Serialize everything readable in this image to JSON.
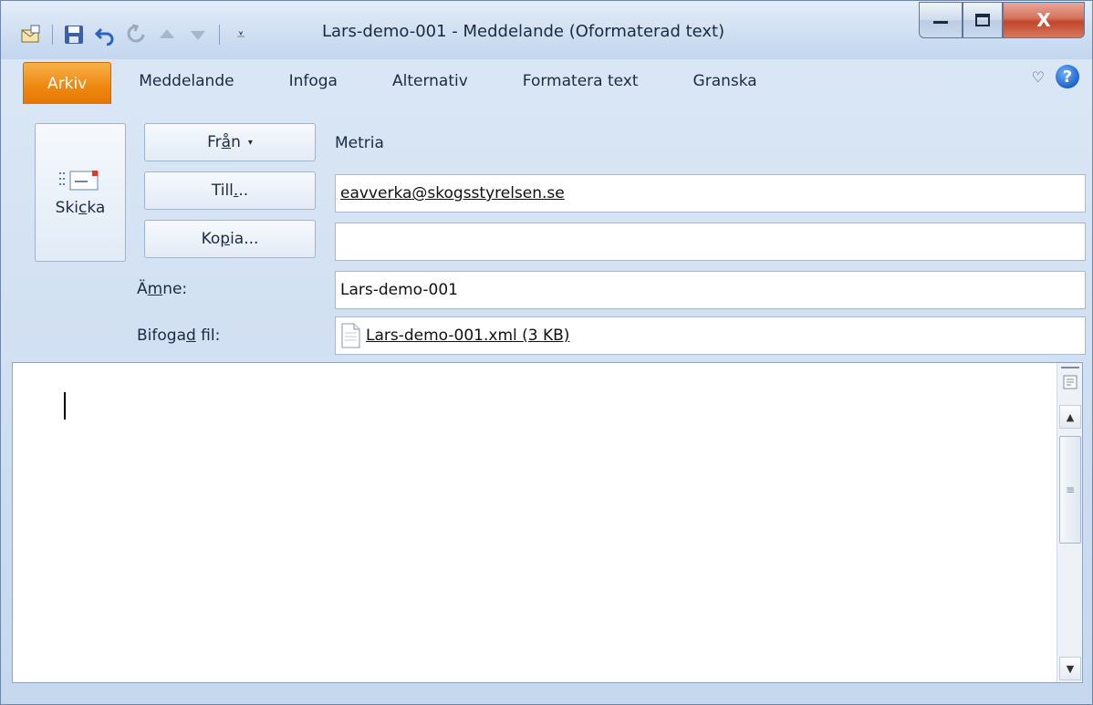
{
  "window": {
    "title": "Lars-demo-001  -  Meddelande (Oformaterad text)",
    "controls": {
      "minimize": "—",
      "maximize": "▢",
      "close": "X"
    }
  },
  "quick_access": {
    "icons": [
      "mail-icon",
      "save-icon",
      "undo-icon",
      "redo-icon",
      "up-arrow-icon",
      "down-arrow-icon",
      "customize-icon"
    ],
    "customize_glyph": "⩡"
  },
  "ribbon": {
    "tabs": [
      {
        "label": "Arkiv"
      },
      {
        "label": "Meddelande"
      },
      {
        "label": "Infoga"
      },
      {
        "label": "Alternativ"
      },
      {
        "label": "Formatera text"
      },
      {
        "label": "Granska"
      }
    ],
    "collapse_glyph": "♡",
    "help_glyph": "?"
  },
  "compose": {
    "send": {
      "pre": "Ski",
      "acc": "c",
      "post": "ka"
    },
    "from_button": {
      "pre": "Fr",
      "acc": "å",
      "post": "n",
      "caret": "▾"
    },
    "from_value": "Metria",
    "to_button": {
      "pre": "Till",
      "acc": ".",
      "post": ".."
    },
    "to_value": "eavverka@skogsstyrelsen.se",
    "cc_button": {
      "pre": "Ko",
      "acc": "p",
      "post": "ia..."
    },
    "cc_value": "",
    "subject_label": {
      "pre": "Ä",
      "acc": "m",
      "post": "ne:"
    },
    "subject_value": "Lars-demo-001",
    "attachment_label": {
      "pre": "Bifoga",
      "acc": "d",
      "post": " fil:"
    },
    "attachment_value": "Lars-demo-001.xml (3 KB)"
  },
  "body": {
    "text": ""
  },
  "colors": {
    "file_tab": "#ef8a13",
    "close_button": "#c2452a",
    "accent_blue": "#1d64c8"
  }
}
